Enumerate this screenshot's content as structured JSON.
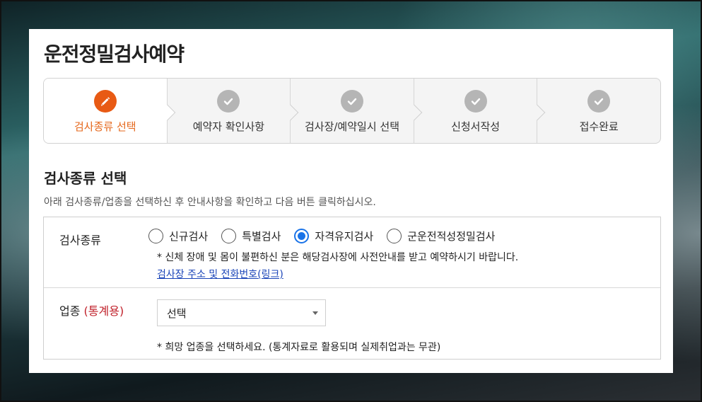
{
  "page": {
    "title": "운전정밀검사예약"
  },
  "steps": [
    {
      "label": "검사종류 선택",
      "icon": "pencil-icon",
      "active": true
    },
    {
      "label": "예약자 확인사항",
      "icon": "check-icon",
      "active": false
    },
    {
      "label": "검사장/예약일시 선택",
      "icon": "check-icon",
      "active": false
    },
    {
      "label": "신청서작성",
      "icon": "check-icon",
      "active": false
    },
    {
      "label": "접수완료",
      "icon": "check-icon",
      "active": false
    }
  ],
  "section": {
    "title": "검사종류 선택",
    "description": "아래 검사종류/업종을 선택하신 후 안내사항을 확인하고 다음 버튼 클릭하십시오."
  },
  "exam_type": {
    "label": "검사종류",
    "options": [
      {
        "label": "신규검사",
        "checked": false
      },
      {
        "label": "특별검사",
        "checked": false
      },
      {
        "label": "자격유지검사",
        "checked": true
      },
      {
        "label": "군운전적성정밀검사",
        "checked": false
      }
    ],
    "notice": "* 신체 장애 및 몸이 불편하신 분은 해당검사장에 사전안내를 받고 예약하시기 바랍니다.",
    "link_text": "검사장 주소 및 전화번호(링크)"
  },
  "industry": {
    "label": "업종",
    "label_note": "(통계용)",
    "selected": "선택",
    "hint": "* 희망 업종을 선택하세요. (통계자료로 활용되며 실제취업과는 무관)"
  },
  "colors": {
    "accent": "#e85a14",
    "active_text": "#e5671b",
    "inactive_icon": "#b5b5b5",
    "radio_checked": "#1a73e8",
    "link": "#1a44b8",
    "stat_note": "#c0202a"
  }
}
